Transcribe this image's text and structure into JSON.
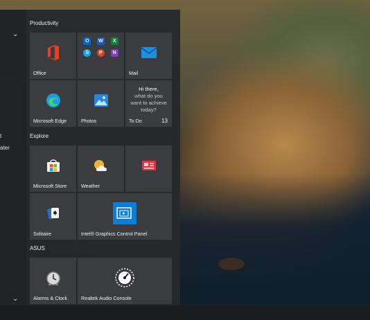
{
  "groups": {
    "productivity": "Productivity",
    "explore": "Explore",
    "asus": "ASUS"
  },
  "rail": {
    "frag1": "t",
    "frag2": "ater"
  },
  "tiles": {
    "office": "Office",
    "mail": "Mail",
    "edge": "Microsoft Edge",
    "photos": "Photos",
    "todo": {
      "label": "To Do",
      "count": "13",
      "line1": "Hi there,",
      "line2": "what do you",
      "line3": "want to achieve",
      "line4": "today?"
    },
    "store": "Microsoft Store",
    "weather": "Weather",
    "solitaire": "Solitaire",
    "intel": "Intel® Graphics Control Panel",
    "alarms": "Alarms & Clock",
    "realtek": "Realtek Audio Console"
  },
  "mini_apps": [
    {
      "name": "outlook",
      "letter": "O",
      "color": "#0a64c8"
    },
    {
      "name": "word",
      "letter": "W",
      "color": "#1e5bb8"
    },
    {
      "name": "excel",
      "letter": "X",
      "color": "#1f7a44"
    },
    {
      "name": "skype",
      "letter": "S",
      "color": "#1aa3e8"
    },
    {
      "name": "powerpoint",
      "letter": "P",
      "color": "#d24726"
    },
    {
      "name": "onenote",
      "letter": "N",
      "color": "#7f3fb5"
    }
  ],
  "colors": {
    "tile": "#3a3c3f",
    "menu": "#26282b"
  }
}
